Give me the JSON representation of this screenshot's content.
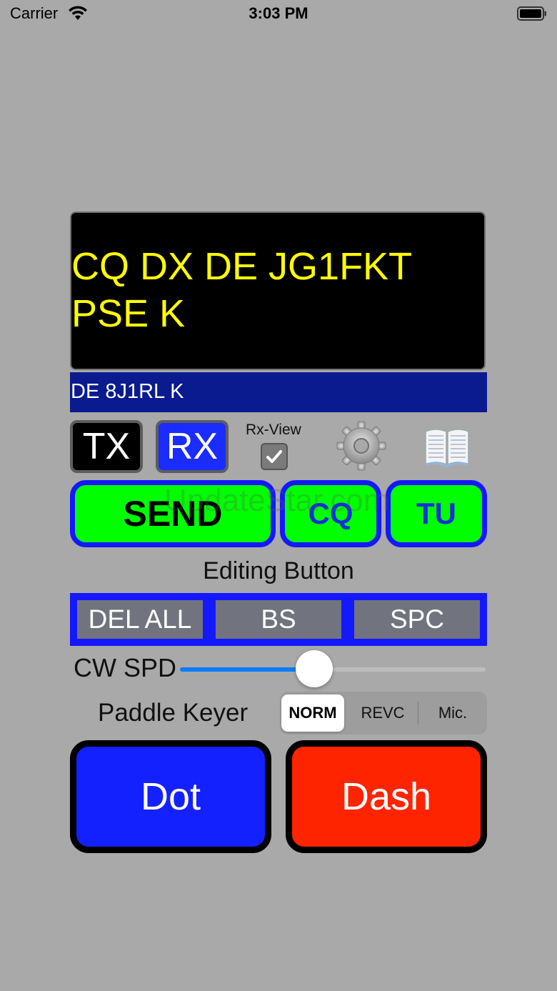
{
  "status_bar": {
    "carrier": "Carrier",
    "time": "3:03 PM",
    "icons": [
      "wifi-icon",
      "battery-icon"
    ]
  },
  "display": {
    "text": "CQ DX DE JG1FKT\nPSE K",
    "text_color": "#ffff00",
    "background": "#000000"
  },
  "rx_line": {
    "text": "DE 8J1RL K",
    "background": "#0a1b8f"
  },
  "controls": {
    "tx_label": "TX",
    "rx_label": "RX",
    "rx_view_label": "Rx-View",
    "rx_view_checked": true,
    "settings_icon": "gear-icon",
    "log_icon": "book-icon"
  },
  "macros": {
    "send_label": "SEND",
    "cq_label": "CQ",
    "tu_label": "TU",
    "accent": "#00ff00",
    "border": "#1418ff"
  },
  "watermark": "UpdateStar.com",
  "editing": {
    "title": "Editing Button",
    "del_all": "DEL ALL",
    "bs": "BS",
    "spc": "SPC"
  },
  "speed": {
    "label": "CW SPD",
    "level": 0.44
  },
  "keyer": {
    "label": "Paddle Keyer",
    "options": [
      "NORM",
      "REVC",
      "Mic."
    ],
    "selected": "NORM"
  },
  "paddles": {
    "dot_label": "Dot",
    "dash_label": "Dash",
    "dot_color": "#1421ff",
    "dash_color": "#ff2400"
  }
}
